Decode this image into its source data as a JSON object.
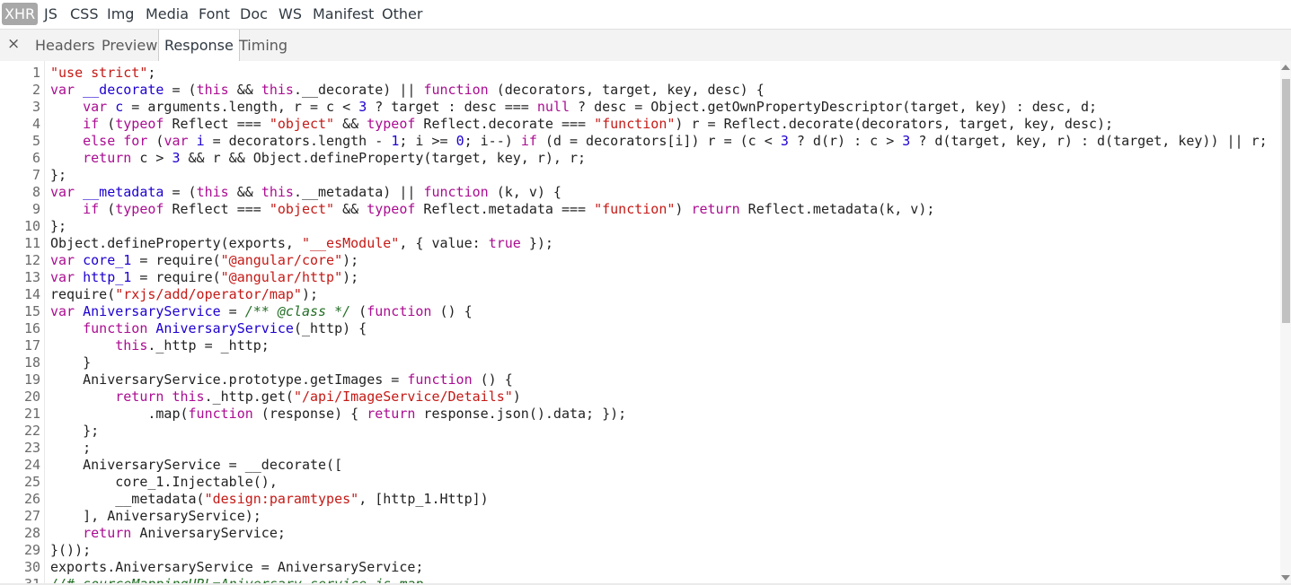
{
  "filters": [
    "XHR",
    "JS",
    "CSS",
    "Img",
    "Media",
    "Font",
    "Doc",
    "WS",
    "Manifest",
    "Other"
  ],
  "active_filter": "XHR",
  "tabs": {
    "close": "×",
    "headers": "Headers",
    "preview": "Preview",
    "response": "Response",
    "timing": "Timing"
  },
  "selected_tab": "Response",
  "colors": {
    "keyword": "#aa0d91",
    "string": "#c41a16",
    "value": "#1c00cf",
    "comment": "#236e25",
    "text": "#222222",
    "active_filter_bg": "#a8a8a8"
  },
  "code_lines": [
    "\"use strict\";",
    "var __decorate = (this && this.__decorate) || function (decorators, target, key, desc) {",
    "    var c = arguments.length, r = c < 3 ? target : desc === null ? desc = Object.getOwnPropertyDescriptor(target, key) : desc, d;",
    "    if (typeof Reflect === \"object\" && typeof Reflect.decorate === \"function\") r = Reflect.decorate(decorators, target, key, desc);",
    "    else for (var i = decorators.length - 1; i >= 0; i--) if (d = decorators[i]) r = (c < 3 ? d(r) : c > 3 ? d(target, key, r) : d(target, key)) || r;",
    "    return c > 3 && r && Object.defineProperty(target, key, r), r;",
    "};",
    "var __metadata = (this && this.__metadata) || function (k, v) {",
    "    if (typeof Reflect === \"object\" && typeof Reflect.metadata === \"function\") return Reflect.metadata(k, v);",
    "};",
    "Object.defineProperty(exports, \"__esModule\", { value: true });",
    "var core_1 = require(\"@angular/core\");",
    "var http_1 = require(\"@angular/http\");",
    "require(\"rxjs/add/operator/map\");",
    "var AniversaryService = /** @class */ (function () {",
    "    function AniversaryService(_http) {",
    "        this._http = _http;",
    "    }",
    "    AniversaryService.prototype.getImages = function () {",
    "        return this._http.get(\"/api/ImageService/Details\")",
    "            .map(function (response) { return response.json().data; });",
    "    };",
    "    ;",
    "    AniversaryService = __decorate([",
    "        core_1.Injectable(),",
    "        __metadata(\"design:paramtypes\", [http_1.Http])",
    "    ], AniversaryService);",
    "    return AniversaryService;",
    "}());",
    "exports.AniversaryService = AniversaryService;",
    "//# sourceMappingURL=Aniversary.service.js.map"
  ]
}
